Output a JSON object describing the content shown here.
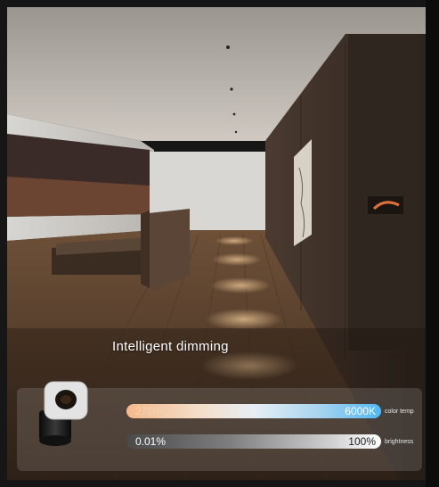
{
  "overlay": {
    "heading": "Intelligent dimming",
    "color_temp": {
      "min_label": "2700K",
      "max_label": "6000K",
      "caption": "color temp"
    },
    "brightness": {
      "min_label": "0.01%",
      "max_label": "100%",
      "caption": "brightness"
    }
  },
  "colors": {
    "warm": "#f5b98a",
    "cool": "#52b8f2",
    "wood_floor": "#5a3f2a",
    "wall_panel": "#3a2c24"
  },
  "icons": [
    "downlight-device-icon"
  ]
}
